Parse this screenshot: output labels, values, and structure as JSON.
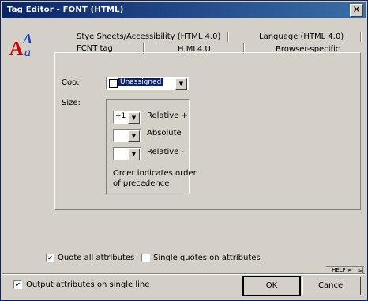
{
  "window": {
    "title": "Tag Editor - FONT   (HTML)"
  },
  "tabs_back": {
    "style_sheets": "Stye Sheets/Accessibility (HTML 4.0)",
    "language": "Language (HTML 4.0)"
  },
  "tabs_front": {
    "font_tag": "FCNT tag",
    "html4": "H ML4.U",
    "browser": "Browser-specific"
  },
  "color": {
    "label": "Coo:",
    "value": "Unassigned"
  },
  "size": {
    "label": "Size:",
    "relative_plus": {
      "value": "+1",
      "label": "Relative +"
    },
    "absolute": {
      "value": "",
      "label": "Absolute"
    },
    "relative_minus": {
      "value": "",
      "label": "Relative -"
    },
    "note_line1": "Orcer indicates order",
    "note_line2": "of precedence"
  },
  "options": {
    "quote_all": {
      "label": "Quote all attributes",
      "checked": true
    },
    "single_quotes": {
      "label": "Single quotes on attributes",
      "checked": false
    },
    "output_single_line": {
      "label": "Output attributes on single line",
      "checked": true
    }
  },
  "help_label": "HELP ≠ | ≤|",
  "buttons": {
    "ok": "OK",
    "cancel": "Cancel"
  }
}
